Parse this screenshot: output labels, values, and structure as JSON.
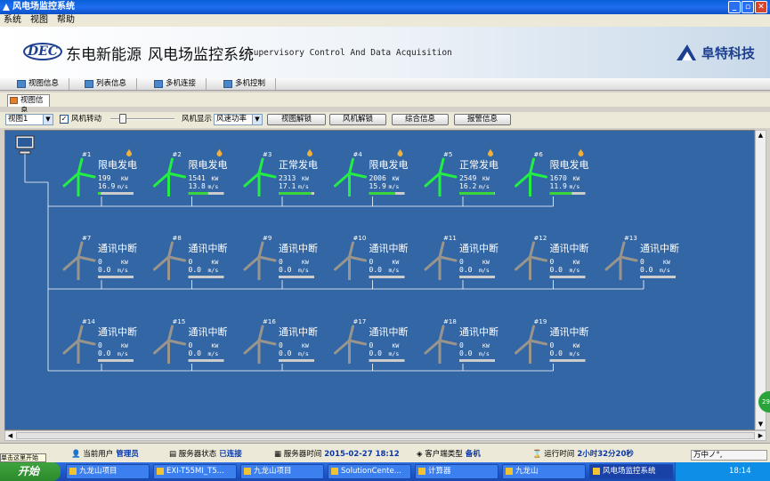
{
  "window": {
    "title": "风电场监控系统"
  },
  "menu": [
    "系统",
    "视图",
    "帮助"
  ],
  "banner": {
    "logo_text": "DEC",
    "brand": "东电新能源",
    "system_cn": "风电场监控系统",
    "system_en": "Supervisory Control And Data Acquisition",
    "corp": "阜特科技"
  },
  "toolbar": [
    "视图信息",
    "列表信息",
    "多机连接",
    "多机控制"
  ],
  "page_tab": "视图信息",
  "controls": {
    "view_select": "视图1",
    "rotate_label": "风机转动",
    "rotate_checked": true,
    "display_label": "风机显示",
    "display_select": "风速功率",
    "buttons": [
      "视图解锁",
      "风机解锁",
      "综合信息",
      "报警信息"
    ]
  },
  "colors": {
    "canvas_bg": "#3366a4",
    "online_blade": "#22ee44",
    "offline_blade": "#9a958c",
    "bar_bg": "#cccccc",
    "bar_fill": "#3ad53a"
  },
  "turbines": [
    {
      "id": "#1",
      "state": "限电发电",
      "power": "199",
      "wind": "16.9",
      "status": "limited",
      "online": true,
      "warn": true,
      "load": 0.08
    },
    {
      "id": "#2",
      "state": "限电发电",
      "power": "1541",
      "wind": "13.8",
      "status": "limited",
      "online": true,
      "warn": true,
      "load": 0.56
    },
    {
      "id": "#3",
      "state": "正常发电",
      "power": "2313",
      "wind": "17.1",
      "status": "normal",
      "online": true,
      "warn": true,
      "load": 0.92
    },
    {
      "id": "#4",
      "state": "限电发电",
      "power": "2006",
      "wind": "15.9",
      "status": "limited",
      "online": true,
      "warn": true,
      "load": 0.74
    },
    {
      "id": "#5",
      "state": "正常发电",
      "power": "2549",
      "wind": "16.2",
      "status": "normal",
      "online": true,
      "warn": true,
      "load": 0.98
    },
    {
      "id": "#6",
      "state": "限电发电",
      "power": "1670",
      "wind": "11.9",
      "status": "limited",
      "online": true,
      "warn": true,
      "load": 0.62
    },
    {
      "id": "#7",
      "state": "通讯中断",
      "power": "0",
      "wind": "0.0",
      "status": "offline",
      "online": false,
      "warn": false,
      "load": 0
    },
    {
      "id": "#8",
      "state": "通讯中断",
      "power": "0",
      "wind": "0.0",
      "status": "offline",
      "online": false,
      "warn": false,
      "load": 0
    },
    {
      "id": "#9",
      "state": "通讯中断",
      "power": "0",
      "wind": "0.0",
      "status": "offline",
      "online": false,
      "warn": false,
      "load": 0
    },
    {
      "id": "#10",
      "state": "通讯中断",
      "power": "0",
      "wind": "0.0",
      "status": "offline",
      "online": false,
      "warn": false,
      "load": 0
    },
    {
      "id": "#11",
      "state": "通讯中断",
      "power": "0",
      "wind": "0.0",
      "status": "offline",
      "online": false,
      "warn": false,
      "load": 0
    },
    {
      "id": "#12",
      "state": "通讯中断",
      "power": "0",
      "wind": "0.0",
      "status": "offline",
      "online": false,
      "warn": false,
      "load": 0
    },
    {
      "id": "#13",
      "state": "通讯中断",
      "power": "0",
      "wind": "0.0",
      "status": "offline",
      "online": false,
      "warn": false,
      "load": 0
    },
    {
      "id": "#14",
      "state": "通讯中断",
      "power": "0",
      "wind": "0.0",
      "status": "offline",
      "online": false,
      "warn": false,
      "load": 0
    },
    {
      "id": "#15",
      "state": "通讯中断",
      "power": "0",
      "wind": "0.0",
      "status": "offline",
      "online": false,
      "warn": false,
      "load": 0
    },
    {
      "id": "#16",
      "state": "通讯中断",
      "power": "0",
      "wind": "0.0",
      "status": "offline",
      "online": false,
      "warn": false,
      "load": 0
    },
    {
      "id": "#17",
      "state": "通讯中断",
      "power": "0",
      "wind": "0.0",
      "status": "offline",
      "online": false,
      "warn": false,
      "load": 0
    },
    {
      "id": "#18",
      "state": "通讯中断",
      "power": "0",
      "wind": "0.0",
      "status": "offline",
      "online": false,
      "warn": false,
      "load": 0
    },
    {
      "id": "#19",
      "state": "通讯中断",
      "power": "0",
      "wind": "0.0",
      "status": "offline",
      "online": false,
      "warn": false,
      "load": 0
    }
  ],
  "units": {
    "power": "KW",
    "wind": "m/s"
  },
  "status": {
    "user_label": "当前用户",
    "user": "管理员",
    "server_label": "服务器状态",
    "server": "已连接",
    "time_label": "服务器时间",
    "time": "2015-02-27 18:12",
    "client_label": "客户端类型",
    "client": "备机",
    "uptime_label": "运行时间",
    "uptime": "2小时32分20秒"
  },
  "start_hint": "单击这里开始",
  "ime": "万中ノ°,",
  "side_badge": "29",
  "taskbar": {
    "start": "开始",
    "items": [
      "九龙山项目",
      "EXI-T55MI_T5...",
      "九龙山项目",
      "SolutionCente...",
      "计算器",
      "九龙山",
      "风电场监控系统"
    ],
    "active_index": 6,
    "clock": "18:14"
  }
}
